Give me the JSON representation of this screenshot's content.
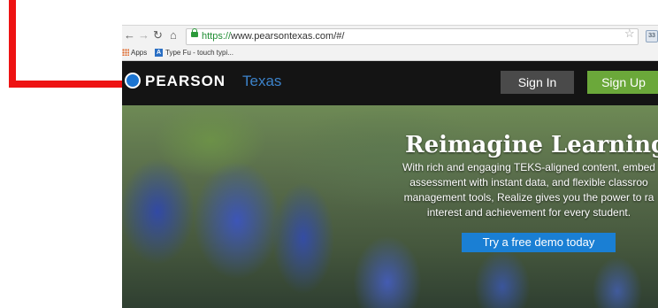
{
  "browser": {
    "url_protocol": "https://",
    "url_rest": "www.pearsontexas.com/#/",
    "bookmarks": [
      "Apps",
      "Type Fu - touch typi..."
    ],
    "ext_icon_text": "33"
  },
  "site": {
    "logo_word": "PEARSON",
    "logo_state": "Texas",
    "sign_in_label": "Sign In",
    "sign_up_label": "Sign Up"
  },
  "hero": {
    "title": "Reimagine Learning",
    "body_lines": [
      "With rich and engaging TEKS-aligned content, embed",
      "assessment with instant data, and flexible classroo",
      "management tools, Realize gives you the power to ra",
      "interest and achievement for every student."
    ],
    "cta_label": "Try a free demo today"
  },
  "colors": {
    "arrow": "#ee1212",
    "sign_up": "#6ba83a",
    "sign_in": "#4a4a4a",
    "cta": "#1a7fd4",
    "header_bg": "#141414"
  }
}
